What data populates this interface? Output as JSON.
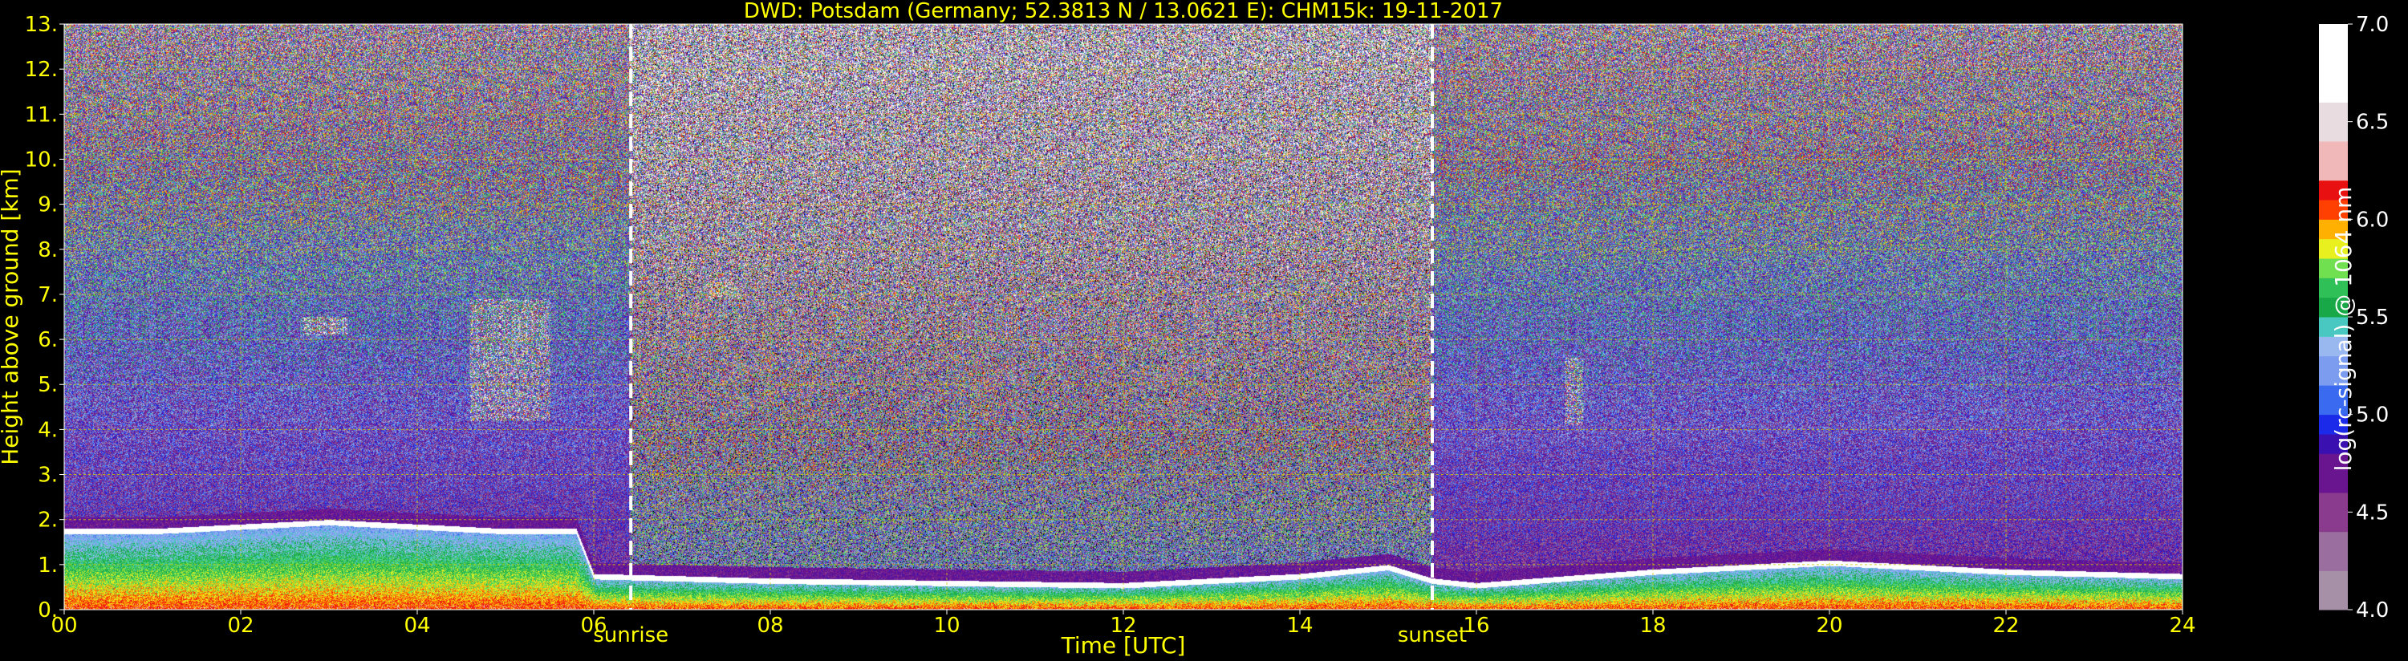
{
  "chart_data": {
    "type": "heatmap",
    "title": "DWD: Potsdam (Germany; 52.3813 N / 13.0621 E):    CHM15k: 19-11-2017",
    "xlabel": "Time [UTC]",
    "ylabel": "Height above ground [km]",
    "xlim": [
      0,
      24
    ],
    "ylim": [
      0,
      13
    ],
    "x_ticks": [
      "00",
      "02",
      "04",
      "06",
      "08",
      "10",
      "12",
      "14",
      "16",
      "18",
      "20",
      "22",
      "24"
    ],
    "y_ticks": [
      "0.",
      "1.",
      "2.",
      "3.",
      "4.",
      "5.",
      "6.",
      "7.",
      "8.",
      "9.",
      "10.",
      "11.",
      "12.",
      "13."
    ],
    "grid": true,
    "events": [
      {
        "label": "sunrise",
        "time": 6.42
      },
      {
        "label": "sunset",
        "time": 15.5
      }
    ],
    "colorbar": {
      "label": "log(rc-signal) @ 1064 nm",
      "range": [
        4.0,
        7.0
      ],
      "ticks": [
        "4.0",
        "4.5",
        "5.0",
        "5.5",
        "6.0",
        "6.5",
        "7.0"
      ]
    },
    "boundary_layer_top_km": [
      [
        0,
        1.8
      ],
      [
        1,
        1.8
      ],
      [
        2,
        1.9
      ],
      [
        3,
        2.0
      ],
      [
        4,
        1.9
      ],
      [
        5,
        1.8
      ],
      [
        5.8,
        1.8
      ],
      [
        6,
        0.8
      ],
      [
        8,
        0.7
      ],
      [
        10,
        0.65
      ],
      [
        12,
        0.6
      ],
      [
        14,
        0.8
      ],
      [
        15,
        1.0
      ],
      [
        15.5,
        0.7
      ],
      [
        16,
        0.6
      ],
      [
        18,
        0.9
      ],
      [
        20,
        1.1
      ],
      [
        22,
        0.9
      ],
      [
        24,
        0.8
      ]
    ],
    "cloud_features": [
      {
        "time": [
          2.7,
          3.2
        ],
        "height": [
          6.1,
          6.5
        ]
      },
      {
        "time": [
          4.6,
          5.5
        ],
        "height": [
          4.2,
          6.9
        ]
      },
      {
        "time": [
          17.0,
          17.2
        ],
        "height": [
          4.1,
          5.6
        ]
      },
      {
        "time": [
          7.3,
          7.6
        ],
        "height": [
          6.9,
          7.3
        ]
      }
    ]
  },
  "colors": {
    "background": "#000000",
    "text": "#ffff00",
    "grid": "#c8c800",
    "event_line": "#ffffff",
    "colorbar_text": "#ffffff"
  }
}
